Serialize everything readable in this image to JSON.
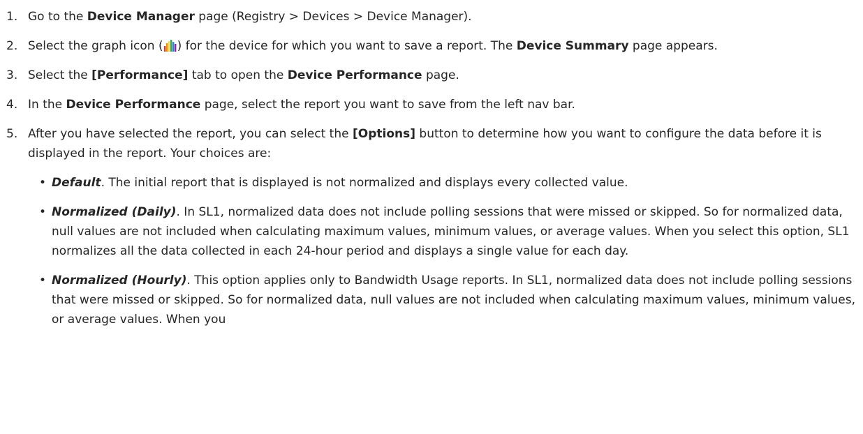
{
  "steps": [
    {
      "num": "1.",
      "parts": [
        "Go to the ",
        "Device Manager",
        " page (Registry > Devices > Device Manager)."
      ]
    },
    {
      "num": "2.",
      "parts": [
        "Select the graph icon (",
        ") for the device for which you want to save a report. The ",
        "Device Summary",
        " page appears."
      ],
      "icon": "graph-icon"
    },
    {
      "num": "3.",
      "parts": [
        "Select the ",
        "[Performance]",
        " tab to open the ",
        "Device Performance",
        " page."
      ]
    },
    {
      "num": "4.",
      "parts": [
        "In the ",
        "Device Performance",
        " page, select the report you want to save from the left nav bar."
      ]
    },
    {
      "num": "5.",
      "parts": [
        "After you have selected the report, you can select the ",
        "[Options]",
        " button to determine how you want to configure the data before it is displayed in the report. Your choices are:"
      ]
    }
  ],
  "choices": [
    {
      "term": "Default",
      "text": ". The initial report that is displayed is not normalized and displays every collected value."
    },
    {
      "term": "Normalized (Daily)",
      "text": ". In SL1, normalized data does not include polling sessions that were missed or skipped. So for normalized data, null values are not included when calculating maximum values, minimum values, or average values. When you select this option, SL1 normalizes all the data collected in each 24-hour period and displays a single value for each day."
    },
    {
      "term": "Normalized (Hourly)",
      "text": ". This option applies only to Bandwidth Usage reports. In SL1, normalized data does not include polling sessions that were missed or skipped. So for normalized data, null values are not included when calculating maximum values, minimum values, or average values. When you"
    }
  ],
  "bullet": "•",
  "colors": {
    "text": "#262626",
    "icon_bars": [
      "#e53935",
      "#fb8c00",
      "#fdd835",
      "#43a047",
      "#1e88e5",
      "#8e24aa"
    ]
  }
}
